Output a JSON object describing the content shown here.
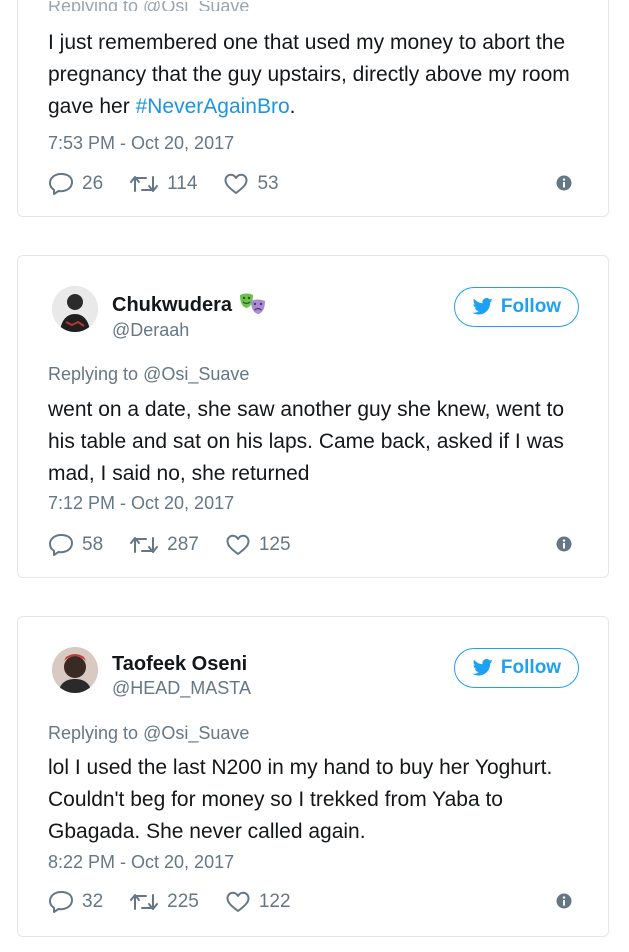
{
  "tweets": [
    {
      "replying_cut": "Replying to @Osi_Suave",
      "text_before": "I just remembered one that used my money to abort the pregnancy that the guy upstairs, directly above my room gave her ",
      "hashtag": "#NeverAgainBro",
      "text_after": ".",
      "time": "7:53 PM - Oct 20, 2017",
      "replies": "26",
      "retweets": "114",
      "likes": "53"
    },
    {
      "name": "Chukwudera",
      "handle": "@Deraah",
      "follow_label": "Follow",
      "replying_prefix": "Replying to",
      "replying_mention": "@Osi_Suave",
      "text": "went on a date, she saw another guy she knew, went to his table and sat on his laps. Came back, asked if I was mad, I said no, she returned",
      "time": "7:12 PM - Oct 20, 2017",
      "replies": "58",
      "retweets": "287",
      "likes": "125"
    },
    {
      "name": "Taofeek Oseni",
      "handle": "@HEAD_MASTA",
      "follow_label": "Follow",
      "replying_prefix": "Replying to",
      "replying_mention": "@Osi_Suave",
      "text": "lol I used the last N200 in my hand to buy her Yoghurt. Couldn't beg for money so I trekked from Yaba to Gbagada. She never called again.",
      "time": "8:22 PM - Oct 20, 2017",
      "replies": "32",
      "retweets": "225",
      "likes": "122"
    }
  ],
  "colors": {
    "accent": "#1da1f2",
    "hashtag": "#1b95e0",
    "muted": "#657786",
    "border": "#e1e8ed"
  },
  "icons": [
    "reply-icon",
    "retweet-icon",
    "like-icon",
    "info-icon",
    "twitter-bird-icon",
    "theater-masks-emoji"
  ]
}
